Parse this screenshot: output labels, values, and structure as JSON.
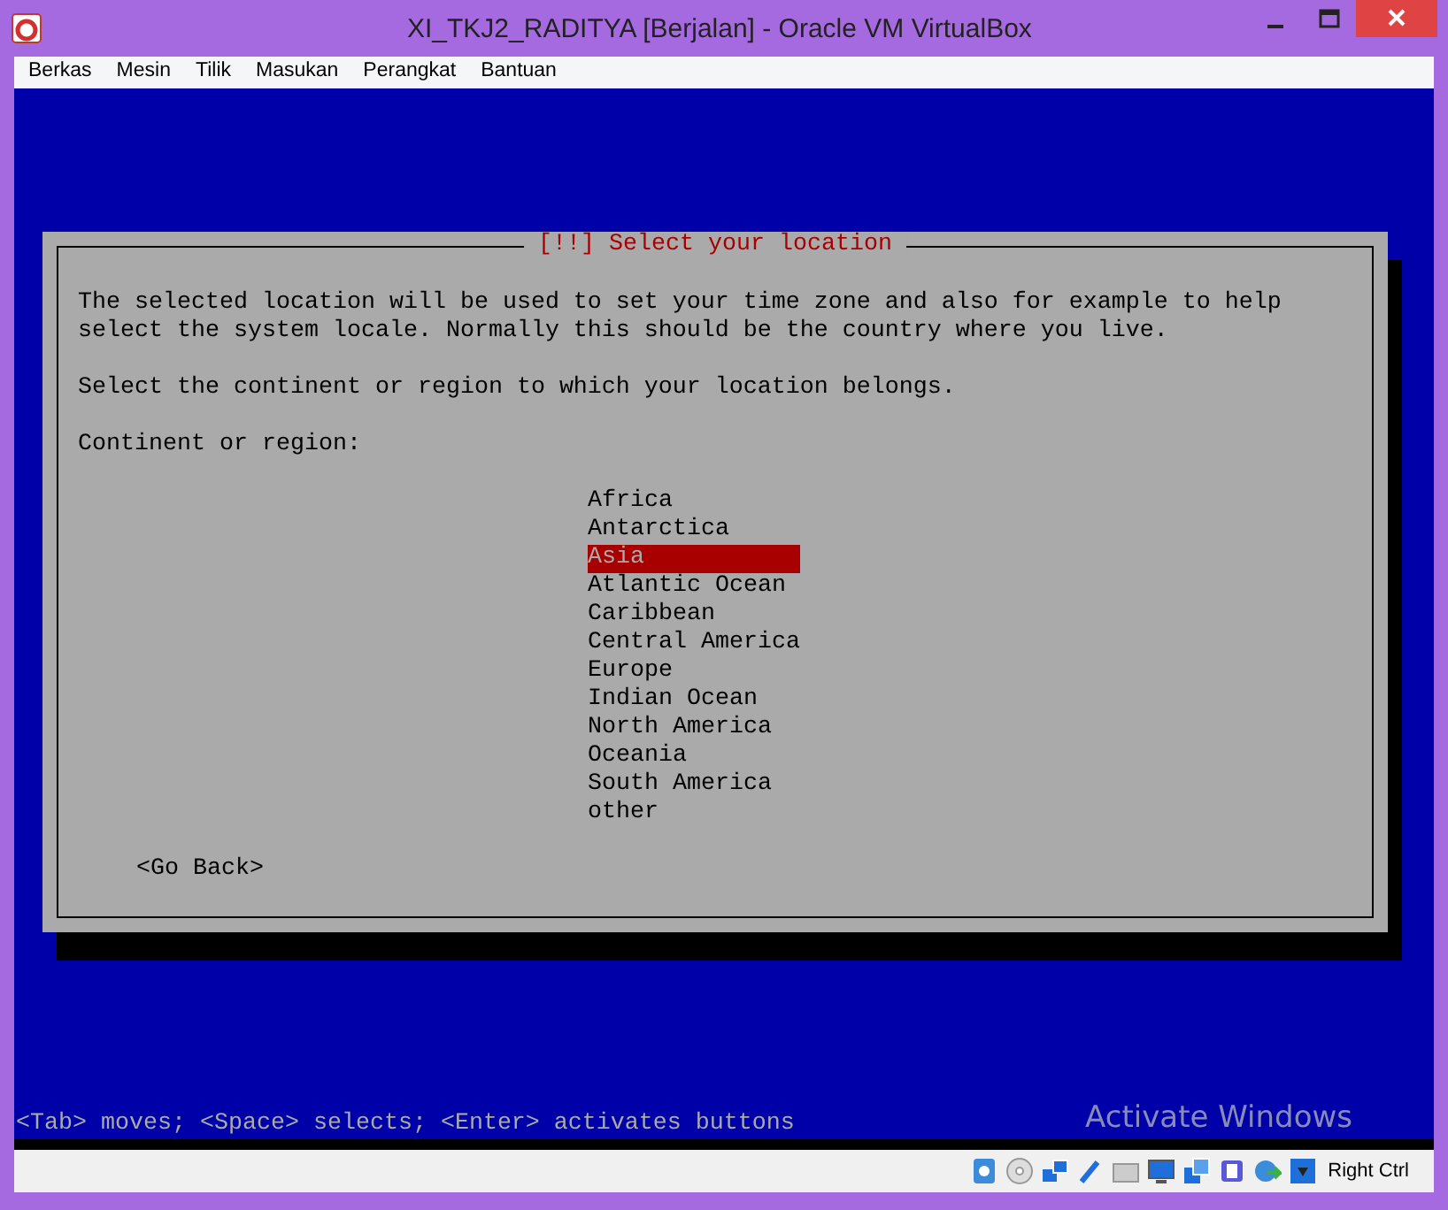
{
  "window": {
    "title": "XI_TKJ2_RADITYA [Berjalan] - Oracle VM VirtualBox"
  },
  "menu": [
    "Berkas",
    "Mesin",
    "Tilik",
    "Masukan",
    "Perangkat",
    "Bantuan"
  ],
  "dialog": {
    "title": "[!!] Select your location",
    "description": "The selected location will be used to set your time zone and also for example to help select the system locale. Normally this should be the country where you live.",
    "instruction": "Select the continent or region to which your location belongs.",
    "list_label": "Continent or region:",
    "options": [
      {
        "label": "Africa",
        "selected": false
      },
      {
        "label": "Antarctica",
        "selected": false
      },
      {
        "label": "Asia",
        "selected": true
      },
      {
        "label": "Atlantic Ocean",
        "selected": false
      },
      {
        "label": "Caribbean",
        "selected": false
      },
      {
        "label": "Central America",
        "selected": false
      },
      {
        "label": "Europe",
        "selected": false
      },
      {
        "label": "Indian Ocean",
        "selected": false
      },
      {
        "label": "North America",
        "selected": false
      },
      {
        "label": "Oceania",
        "selected": false
      },
      {
        "label": "South America",
        "selected": false
      },
      {
        "label": "other",
        "selected": false
      }
    ],
    "back_button": "<Go Back>"
  },
  "help_line": "<Tab> moves; <Space> selects; <Enter> activates buttons",
  "overlay_text": "Activate Windows",
  "status_bar": {
    "host_key": "Right Ctrl"
  }
}
